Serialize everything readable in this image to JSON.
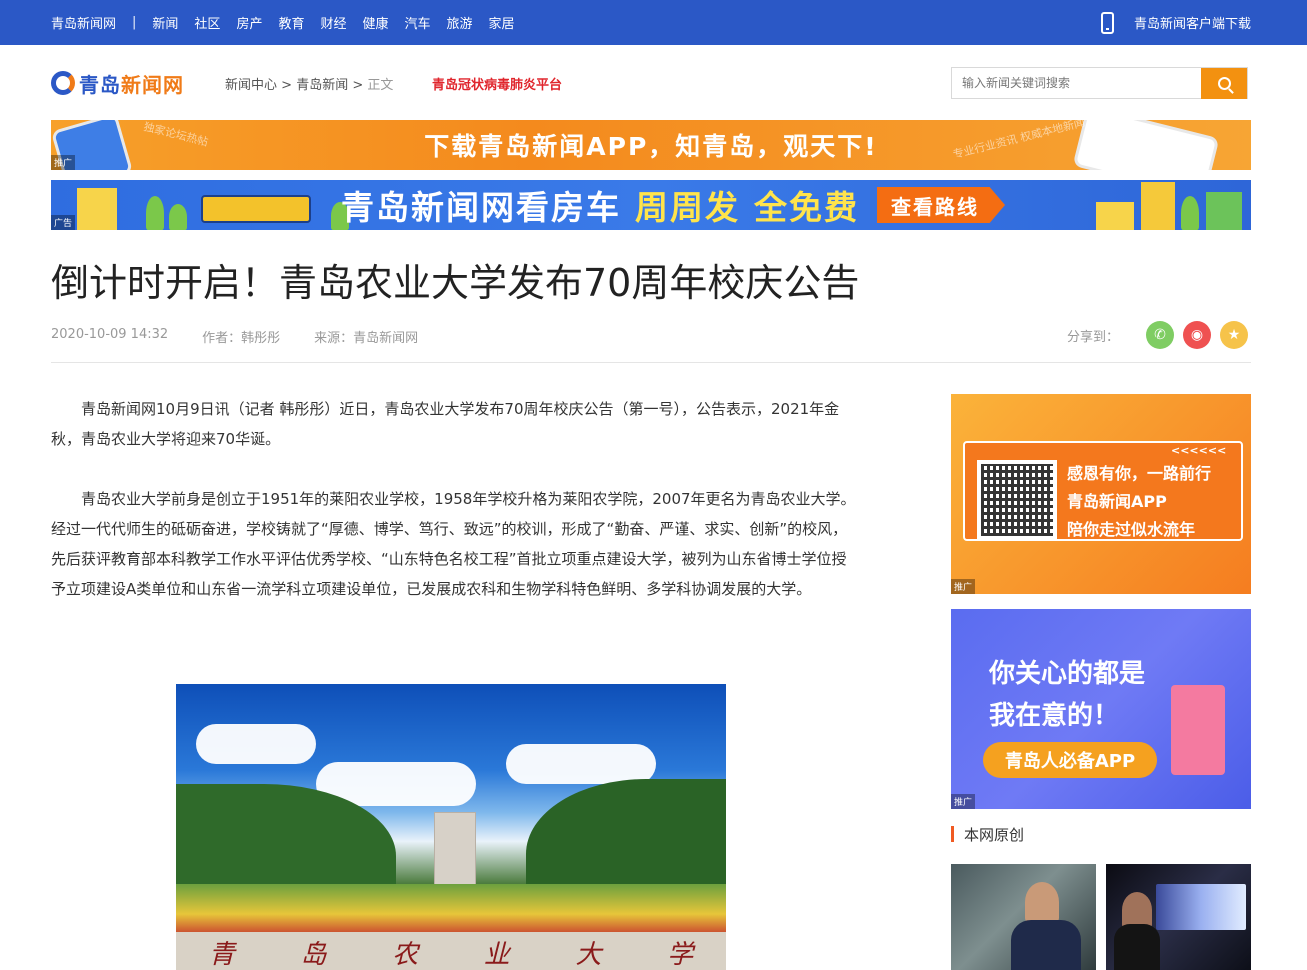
{
  "topbar": {
    "site": "青岛新闻网",
    "separator": "|",
    "nav": [
      "新闻",
      "社区",
      "房产",
      "教育",
      "财经",
      "健康",
      "汽车",
      "旅游",
      "家居"
    ],
    "app_download": "青岛新闻客户端下载",
    "bg": "#2b58c6"
  },
  "header": {
    "logo_a": "青岛",
    "logo_b": "新闻网",
    "breadcrumb": [
      "新闻中心",
      ">",
      "青岛新闻",
      ">",
      "正文"
    ],
    "covid_link": "青岛冠状病毒肺炎平台",
    "search_placeholder": "输入新闻关键词搜索"
  },
  "banners": {
    "app": {
      "text": "下载青岛新闻APP，知青岛，观天下!",
      "tag": "推广",
      "deco_left": "独家论坛热帖",
      "deco_right": "专业行业资讯 权威本地新闻"
    },
    "house": {
      "text_a": "青岛新闻网看房车",
      "text_b": "周周发",
      "text_c": "全免费",
      "button": "查看路线",
      "tag": "广告"
    }
  },
  "article": {
    "title": "倒计时开启！青岛农业大学发布70周年校庆公告",
    "date": "2020-10-09 14:32",
    "author": "作者：韩彤彤",
    "source": "来源：青岛新闻网",
    "share_label": "分享到：",
    "paragraphs": [
      "青岛新闻网10月9日讯（记者 韩彤彤）近日，青岛农业大学发布70周年校庆公告（第一号），公告表示，2021年金秋，青岛农业大学将迎来70华诞。",
      "青岛农业大学前身是创立于1951年的莱阳农业学校，1958年学校升格为莱阳农学院，2007年更名为青岛农业大学。经过一代代师生的砥砺奋进，学校铸就了“厚德、博学、笃行、致远”的校训，形成了“勤奋、严谨、求实、创新”的校风，先后获评教育部本科教学工作水平评估优秀学校、“山东特色名校工程”首批立项重点建设大学，被列为山东省博士学位授予立项建设A类单位和山东省一流学科立项建设单位，已发展成农科和生物学科特色鲜明、多学科协调发展的大学。"
    ],
    "photo_inscription": [
      "青",
      "岛",
      "农",
      "业",
      "大",
      "学"
    ]
  },
  "sidebar": {
    "ad1": {
      "lines": [
        "感恩有你，一路前行",
        "青岛新闻APP",
        "陪你走过似水流年"
      ],
      "arrows": "<<<<<<",
      "tag": "推广"
    },
    "ad2": {
      "line1": "你关心的都是",
      "line2": "我在意的！",
      "pill": "青岛人必备APP",
      "tag": "推广"
    },
    "section_title": "本网原创"
  }
}
